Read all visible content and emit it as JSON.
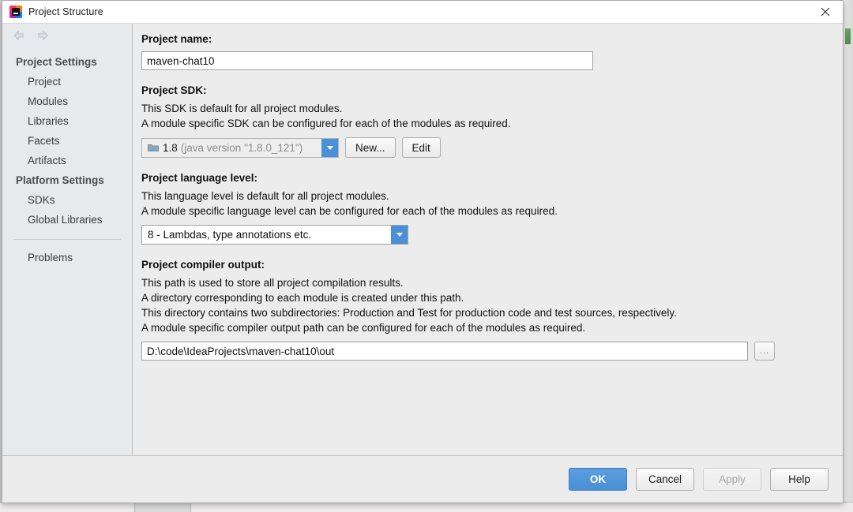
{
  "window": {
    "title": "Project Structure",
    "app_icon": "intellij-idea-logo",
    "close_label": "×"
  },
  "nav": {
    "back_icon": "arrow-left-icon",
    "forward_icon": "arrow-right-icon"
  },
  "sidebar": {
    "groups": [
      {
        "label": "Project Settings",
        "items": [
          "Project",
          "Modules",
          "Libraries",
          "Facets",
          "Artifacts"
        ]
      },
      {
        "label": "Platform Settings",
        "items": [
          "SDKs",
          "Global Libraries"
        ]
      }
    ],
    "extra_items": [
      "Problems"
    ]
  },
  "content": {
    "project_name": {
      "title": "Project name:",
      "value": "maven-chat10"
    },
    "project_sdk": {
      "title": "Project SDK:",
      "desc_line1": "This SDK is default for all project modules.",
      "desc_line2": "A module specific SDK can be configured for each of the modules as required.",
      "sdk_icon": "jdk-folder-icon",
      "sdk_name": "1.8",
      "sdk_version": "(java version \"1.8.0_121\")",
      "new_button": "New...",
      "edit_button": "Edit"
    },
    "language_level": {
      "title": "Project language level:",
      "desc_line1": "This language level is default for all project modules.",
      "desc_line2": "A module specific language level can be configured for each of the modules as required.",
      "value": "8 - Lambdas, type annotations etc."
    },
    "compiler_output": {
      "title": "Project compiler output:",
      "desc_line1": "This path is used to store all project compilation results.",
      "desc_line2": "A directory corresponding to each module is created under this path.",
      "desc_line3": "This directory contains two subdirectories: Production and Test for production code and test sources, respectively.",
      "desc_line4": "A module specific compiler output path can be configured for each of the modules as required.",
      "value": "D:\\code\\IdeaProjects\\maven-chat10\\out",
      "browse_label": "..."
    }
  },
  "footer": {
    "ok": "OK",
    "cancel": "Cancel",
    "apply": "Apply",
    "help": "Help"
  },
  "colors": {
    "accent": "#4a90d9",
    "ok_button": "#4f94d4",
    "sidebar_bg": "#e6eaed",
    "dialog_bg": "#ececec"
  }
}
